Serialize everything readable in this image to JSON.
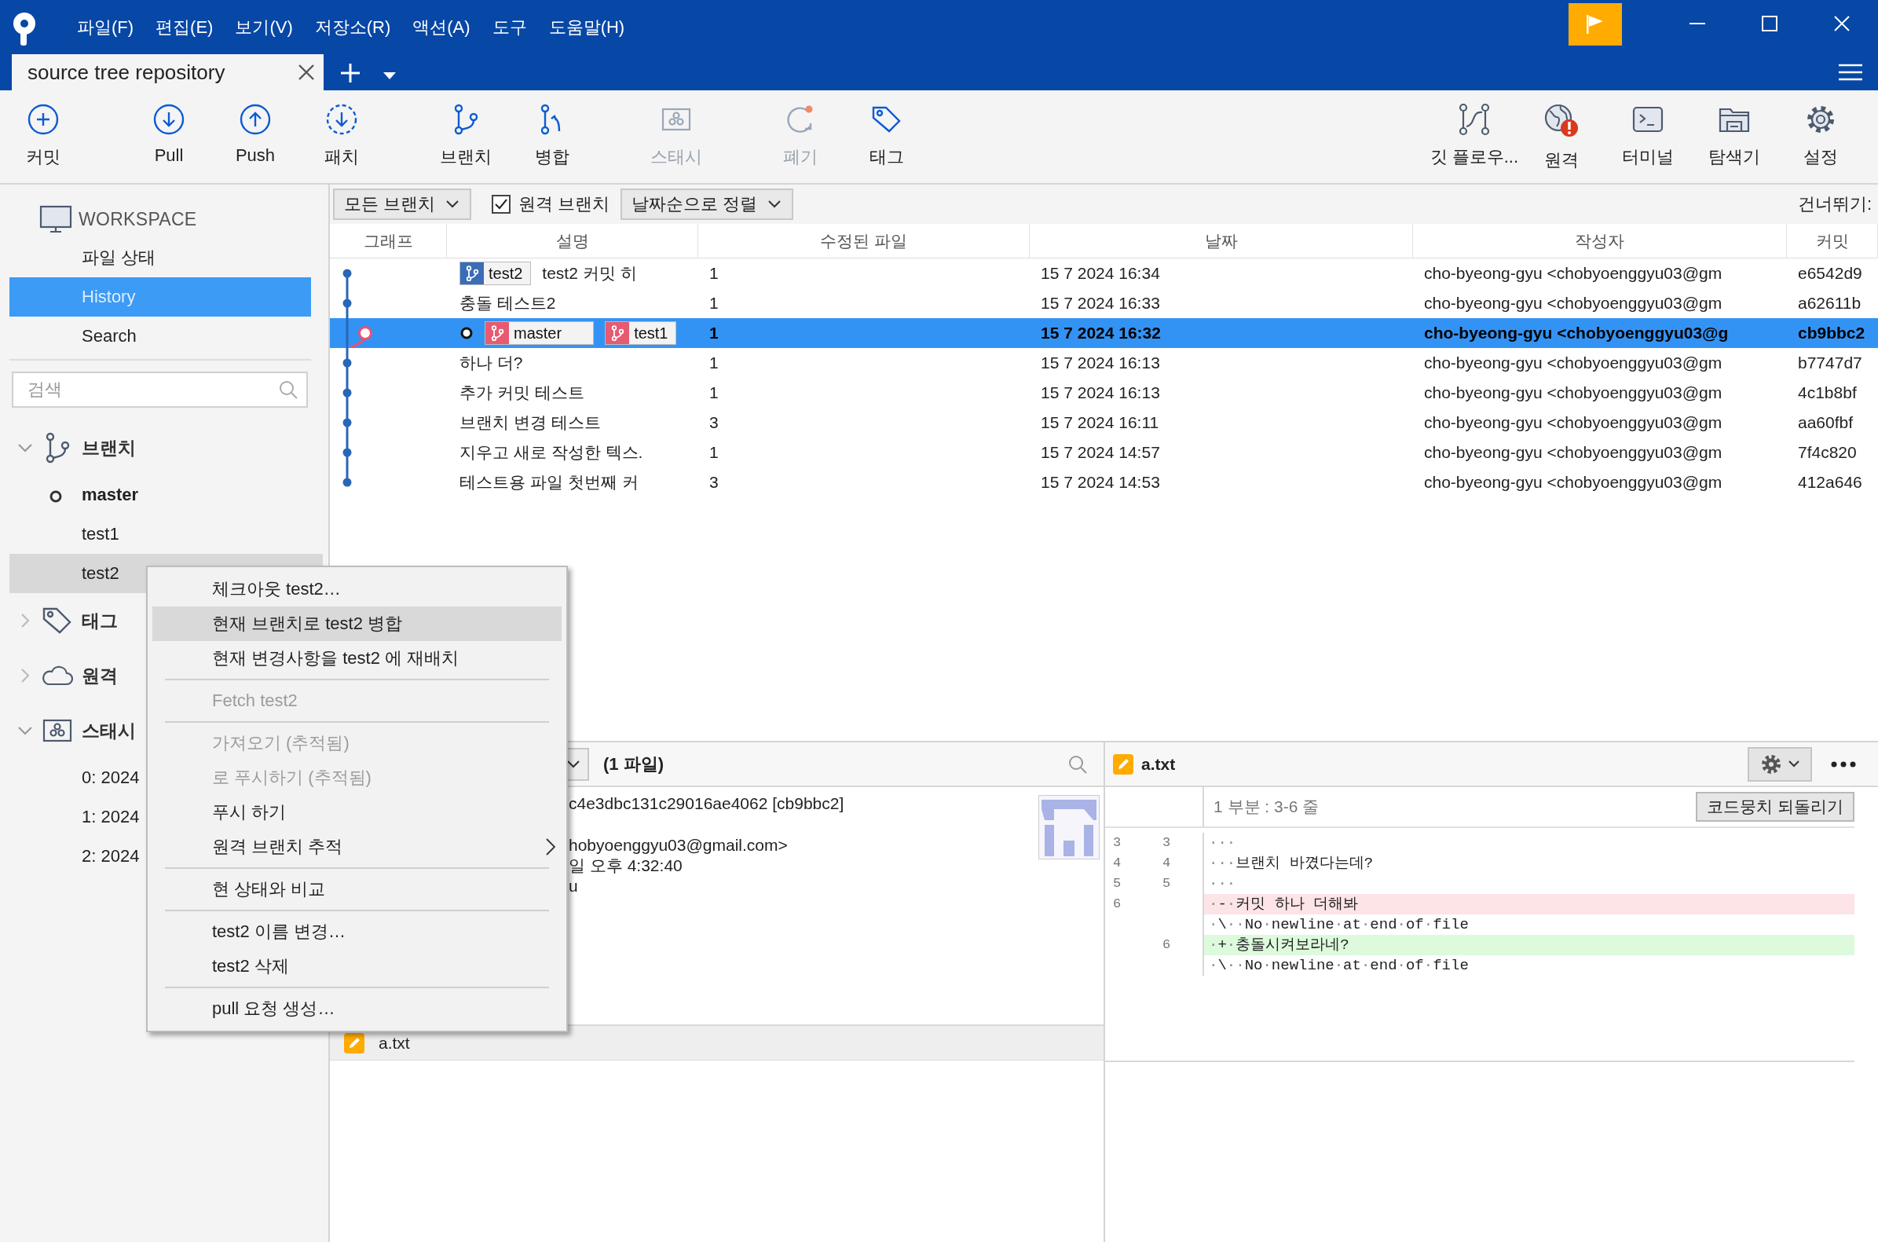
{
  "window": {
    "menus": [
      "파일(F)",
      "편집(E)",
      "보기(V)",
      "저장소(R)",
      "액션(A)",
      "도구",
      "도움말(H)"
    ]
  },
  "tabs": [
    {
      "label": "source tree repository",
      "selected": true
    }
  ],
  "toolbar": {
    "groups": [
      [
        {
          "label": "커밋",
          "disabled": false
        }
      ],
      [
        {
          "label": "Pull",
          "disabled": false
        },
        {
          "label": "Push",
          "disabled": false
        },
        {
          "label": "패치",
          "disabled": false
        }
      ],
      [
        {
          "label": "브랜치",
          "disabled": false
        },
        {
          "label": "병합",
          "disabled": false
        }
      ],
      [
        {
          "label": "스태시",
          "disabled": true
        }
      ],
      [
        {
          "label": "폐기",
          "disabled": true
        },
        {
          "label": "태그",
          "disabled": false
        }
      ]
    ],
    "right": [
      {
        "label": "깃 플로우...",
        "disabled": false
      },
      {
        "label": "원격",
        "disabled": false
      },
      {
        "label": "터미널",
        "disabled": false
      },
      {
        "label": "탐색기",
        "disabled": false
      },
      {
        "label": "설정",
        "disabled": false
      }
    ]
  },
  "sidebar": {
    "workspace": {
      "title": "WORKSPACE",
      "items": [
        {
          "label": "파일 상태",
          "selected": false
        },
        {
          "label": "History",
          "selected": true
        },
        {
          "label": "Search",
          "selected": false
        }
      ]
    },
    "search": {
      "placeholder": "검색"
    },
    "sections": [
      {
        "label": "브랜치",
        "expanded": true,
        "children": [
          {
            "label": "master",
            "current": true,
            "selected": false
          },
          {
            "label": "test1",
            "current": false,
            "selected": false
          },
          {
            "label": "test2",
            "current": false,
            "selected": true
          }
        ]
      },
      {
        "label": "태그",
        "expanded": false
      },
      {
        "label": "원격",
        "expanded": false
      },
      {
        "label": "스태시",
        "expanded": true,
        "children": [
          {
            "label": "0: 2024",
            "current": false,
            "selected": false
          },
          {
            "label": "1: 2024",
            "current": false,
            "selected": false
          },
          {
            "label": "2: 2024",
            "current": false,
            "selected": false
          }
        ]
      }
    ]
  },
  "filters": {
    "branch_filter": "모든 브랜치",
    "remote_branches": {
      "label": "원격 브랜치",
      "checked": true
    },
    "sort": "날짜순으로 정렬",
    "skip_label": "건너뛰기:"
  },
  "table": {
    "columns": [
      "그래프",
      "설명",
      "수정된 파일",
      "날짜",
      "작성자",
      "커밋"
    ],
    "rows": [
      {
        "head": false,
        "refs": [
          {
            "label": "test2",
            "color": "#3a6db5"
          }
        ],
        "description": "test2 커밋 히",
        "files": "1",
        "date": "15 7 2024 16:34",
        "author": "cho-byeong-gyu <chobyoenggyu03@gm",
        "commit": "e6542d9",
        "selected": false
      },
      {
        "head": false,
        "refs": [],
        "description": "충돌 테스트2",
        "files": "1",
        "date": "15 7 2024 16:33",
        "author": "cho-byeong-gyu <chobyoenggyu03@gm",
        "commit": "a62611b",
        "selected": false
      },
      {
        "head": true,
        "refs": [
          {
            "label": "master",
            "color": "#e65a72"
          },
          {
            "label": "test1",
            "color": "#e65a72"
          }
        ],
        "files": "1",
        "date": "15 7 2024 16:32",
        "author": "cho-byeong-gyu <chobyoenggyu03@g",
        "commit": "cb9bbc2",
        "selected": true
      },
      {
        "head": false,
        "refs": [],
        "description": "하나 더?",
        "files": "1",
        "date": "15 7 2024 16:13",
        "author": "cho-byeong-gyu <chobyoenggyu03@gm",
        "commit": "b7747d7",
        "selected": false
      },
      {
        "head": false,
        "refs": [],
        "description": "추가 커밋 테스트",
        "files": "1",
        "date": "15 7 2024 16:13",
        "author": "cho-byeong-gyu <chobyoenggyu03@gm",
        "commit": "4c1b8bf",
        "selected": false
      },
      {
        "head": false,
        "refs": [],
        "description": "브랜치 변경 테스트",
        "files": "3",
        "date": "15 7 2024 16:11",
        "author": "cho-byeong-gyu <chobyoenggyu03@gm",
        "commit": "aa60fbf",
        "selected": false
      },
      {
        "head": false,
        "refs": [],
        "description": "지우고 새로 작성한 텍스.",
        "files": "1",
        "date": "15 7 2024 14:57",
        "author": "cho-byeong-gyu <chobyoenggyu03@gm",
        "commit": "7f4c820",
        "selected": false
      },
      {
        "head": false,
        "refs": [],
        "description": "테스트용 파일 첫번째 커",
        "files": "3",
        "date": "15 7 2024 14:53",
        "author": "cho-byeong-gyu <chobyoenggyu03@gm",
        "commit": "412a646",
        "selected": false
      }
    ]
  },
  "details": {
    "file_count": "(1 파일)",
    "lines": [
      "c4e3dbc131c29016ae4062 [cb9bbc2]",
      "hobyoenggyu03@gmail.com>",
      "일 오후 4:32:40",
      "u"
    ],
    "files": [
      {
        "name": "a.txt",
        "selected": true
      }
    ]
  },
  "diff": {
    "file": "a.txt",
    "hunk": "1 부분 : 3-6 줄",
    "revert_button": "코드뭉치 되돌리기",
    "lines": [
      {
        "old": "3",
        "new": "3",
        "kind": "context",
        "text": "···"
      },
      {
        "old": "4",
        "new": "4",
        "kind": "context",
        "text": "···브랜치 바꼈다는데?"
      },
      {
        "old": "5",
        "new": "5",
        "kind": "context",
        "text": "···"
      },
      {
        "old": "6",
        "kind": "removed",
        "text": "·-·커밋 하나 더해봐"
      },
      {
        "kind": "meta",
        "text": "·\\··No·newline·at·end·of·file"
      },
      {
        "new": "6",
        "kind": "added",
        "text": "·+·충돌시켜보라네?"
      },
      {
        "kind": "meta",
        "text": "·\\··No·newline·at·end·of·file"
      }
    ]
  },
  "context_menu": {
    "items": [
      {
        "kind": "item",
        "label": "체크아웃 test2…",
        "disabled": false,
        "selected": false
      },
      {
        "kind": "item",
        "label": "현재 브랜치로 test2 병합",
        "disabled": false,
        "selected": true
      },
      {
        "kind": "item",
        "label": "현재 변경사항을 test2 에 재배치",
        "disabled": false,
        "selected": false
      },
      {
        "kind": "separator"
      },
      {
        "kind": "item",
        "label": "Fetch test2",
        "disabled": true,
        "selected": false
      },
      {
        "kind": "separator"
      },
      {
        "kind": "item",
        "label": "가져오기 (추적됨)",
        "disabled": true,
        "selected": false
      },
      {
        "kind": "item",
        "label": "로 푸시하기 (추적됨)",
        "disabled": true,
        "selected": false
      },
      {
        "kind": "item",
        "label": "푸시 하기",
        "disabled": false,
        "selected": false
      },
      {
        "kind": "submenu",
        "label": "원격 브랜치 추적",
        "disabled": false,
        "selected": false
      },
      {
        "kind": "separator"
      },
      {
        "kind": "item",
        "label": "현 상태와 비교",
        "disabled": false,
        "selected": false
      },
      {
        "kind": "separator"
      },
      {
        "kind": "item",
        "label": "test2 이름 변경…",
        "disabled": false,
        "selected": false
      },
      {
        "kind": "item",
        "label": "test2 삭제",
        "disabled": false,
        "selected": false
      },
      {
        "kind": "separator"
      },
      {
        "kind": "item",
        "label": "pull 요청 생성…",
        "disabled": false,
        "selected": false
      }
    ]
  }
}
